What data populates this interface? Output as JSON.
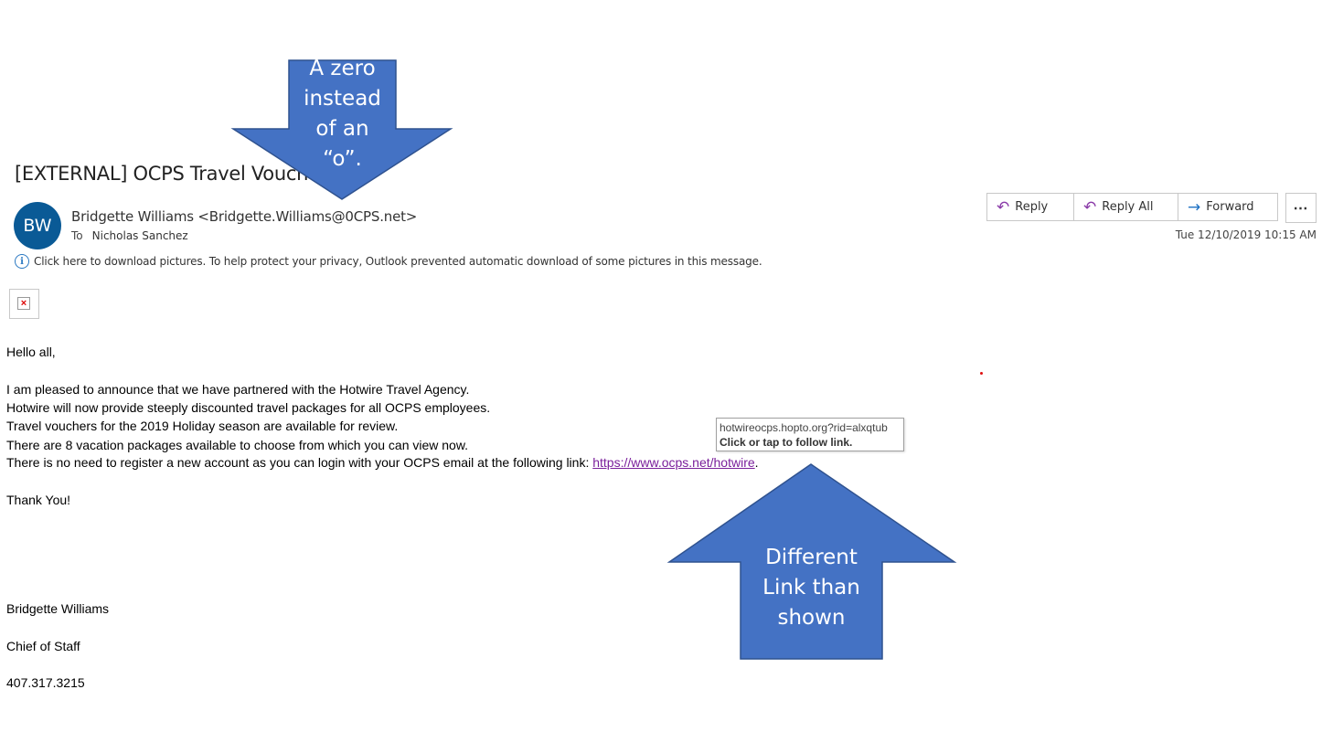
{
  "email": {
    "subject": "[EXTERNAL] OCPS Travel Voucher",
    "sender_initials": "BW",
    "sender": "Bridgette Williams <Bridgette.Williams@0CPS.net>",
    "to_label": "To",
    "to_name": "Nicholas Sanchez",
    "info_bar": "Click here to download pictures. To help protect your privacy, Outlook prevented automatic download of some pictures in this message.",
    "timestamp": "Tue 12/10/2019 10:15 AM"
  },
  "actions": {
    "reply": "Reply",
    "reply_all": "Reply All",
    "forward": "Forward",
    "more": "⋯"
  },
  "body": {
    "greeting": "Hello all,",
    "line1": "I am pleased to announce that we have partnered with the Hotwire Travel Agency.",
    "line2": "Hotwire will now provide steeply discounted travel packages for all OCPS employees.",
    "line3": "Travel vouchers for the 2019 Holiday season are available for review.",
    "line4": "There are 8 vacation packages available to choose from which you can view now.",
    "line5_prefix": "There is no need to register a new account as you can login with your OCPS email at the following link: ",
    "link_text": "https://www.ocps.net/hotwire",
    "line5_suffix": ".",
    "closing": "Thank You!",
    "sig_name": "Bridgette Williams",
    "sig_title": "Chief of Staff",
    "sig_phone": "407.317.3215"
  },
  "tooltip": {
    "url": "hotwireocps.hopto.org?rid=alxqtub",
    "hint": "Click or tap to follow link."
  },
  "annotations": {
    "top_arrow_lines": [
      "A zero",
      "instead",
      "of an",
      "“o”."
    ],
    "bottom_arrow_lines": [
      "Different",
      "Link than",
      "shown"
    ],
    "arrow_color": "#4472c4"
  }
}
